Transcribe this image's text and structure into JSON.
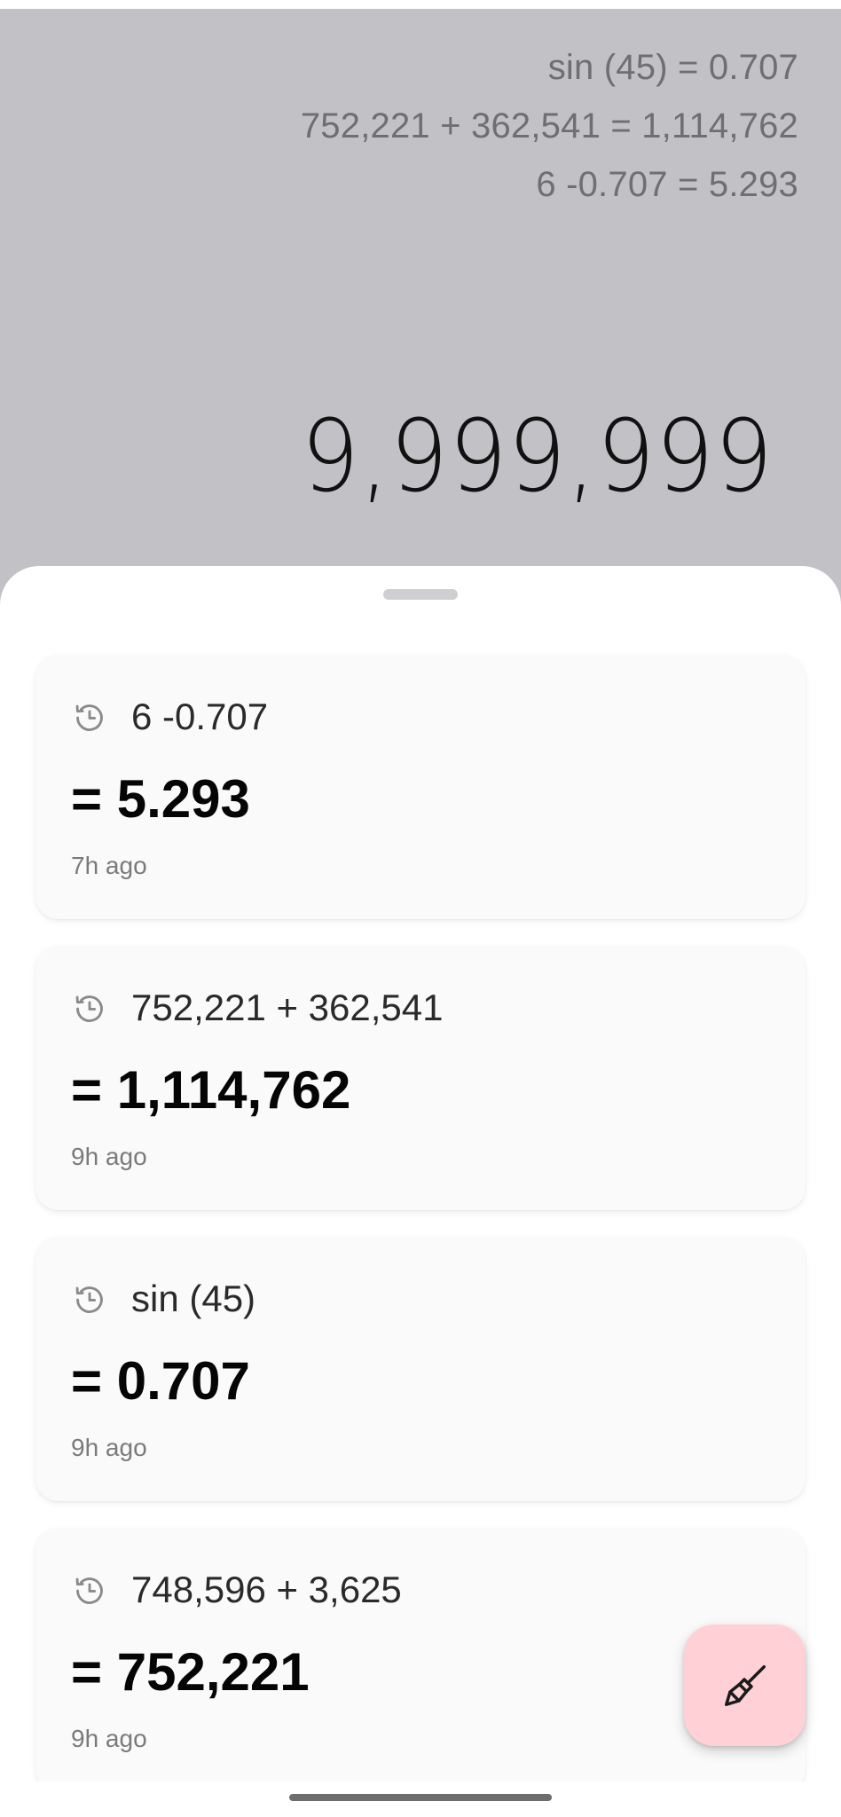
{
  "display": {
    "history": [
      "sin (45) = 0.707",
      "752,221 + 362,541 = 1,114,762",
      "6 -0.707 = 5.293"
    ],
    "current_value": "9,999,999"
  },
  "history_sheet": {
    "items": [
      {
        "expression": "6 -0.707",
        "result": "= 5.293",
        "time": "7h ago",
        "icon": "history-clock-icon"
      },
      {
        "expression": "752,221 + 362,541",
        "result": "= 1,114,762",
        "time": "9h ago",
        "icon": "history-clock-icon"
      },
      {
        "expression": "sin (45)",
        "result": "= 0.707",
        "time": "9h ago",
        "icon": "history-clock-icon"
      },
      {
        "expression": "748,596 + 3,625",
        "result": "= 752,221",
        "time": "9h ago",
        "icon": "history-clock-icon"
      }
    ],
    "fab_icon": "broom-icon"
  },
  "colors": {
    "display_background": "#c2c1c6",
    "sheet_background": "#ffffff",
    "card_background": "#fafafa",
    "fab_background": "#ffd1d6"
  }
}
